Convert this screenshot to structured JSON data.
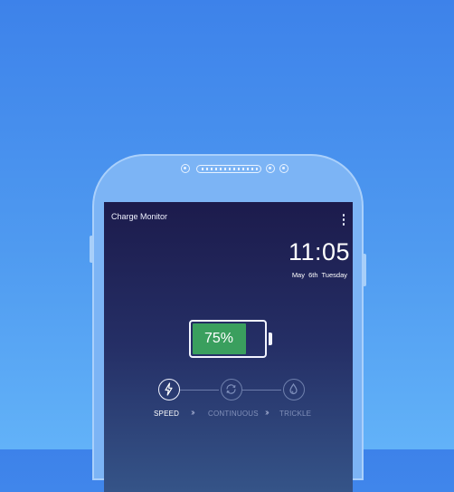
{
  "app": {
    "title": "Charge Monitor",
    "menu_icon": "more-vertical-icon"
  },
  "clock": {
    "time": "11:05",
    "date": "May 6th",
    "weekday": "Tuesday"
  },
  "battery": {
    "percent_label": "75%",
    "level": 0.75,
    "fill_color": "#3a9f5e"
  },
  "charging_stages": [
    {
      "label": "SPEED",
      "icon": "lightning-bolt-icon",
      "active": true
    },
    {
      "label": "CONTINUOUS",
      "icon": "refresh-cycle-icon",
      "active": false
    },
    {
      "label": "TRICKLE",
      "icon": "water-drop-icon",
      "active": false
    }
  ],
  "colors": {
    "background": "#3d82ea",
    "phone_body": "#7cb4f5",
    "screen_top": "#1c1b4c",
    "screen_bottom": "#355488",
    "battery_fill": "#3a9f5e"
  }
}
